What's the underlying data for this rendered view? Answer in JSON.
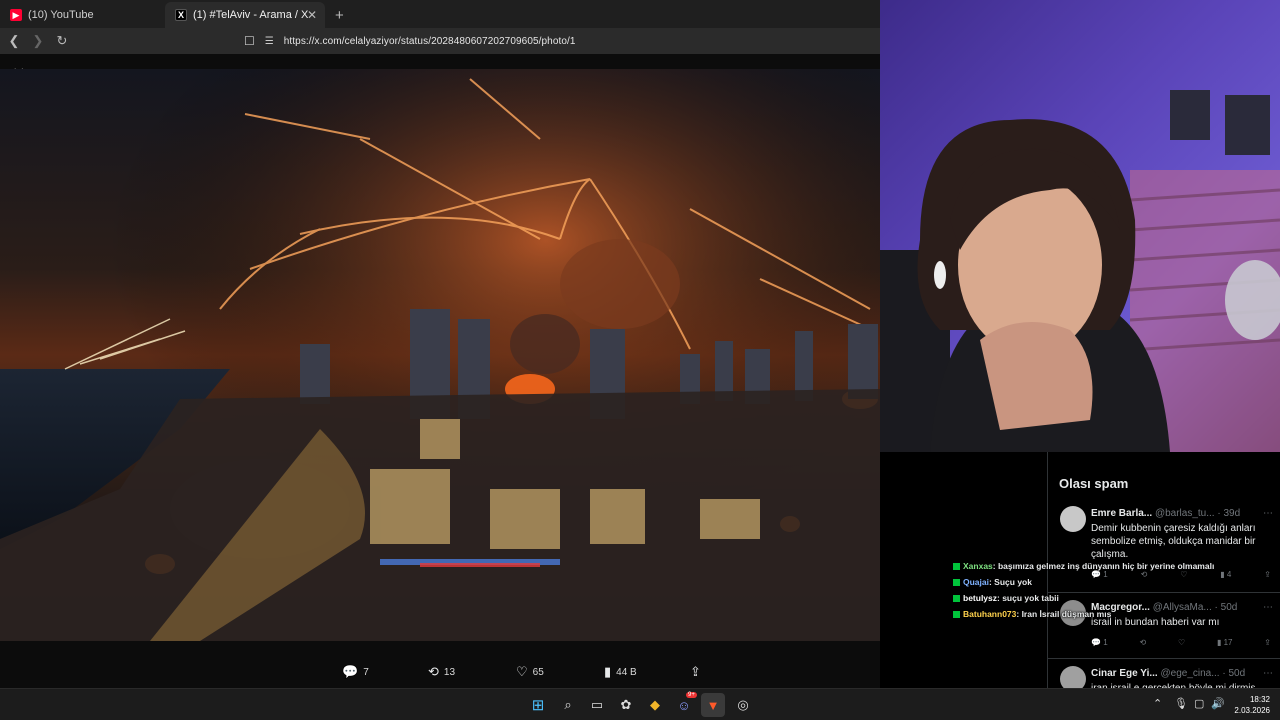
{
  "browser": {
    "tabs": [
      {
        "title": "(10) YouTube",
        "icon": "youtube-icon",
        "active": false
      },
      {
        "title": "(1) #TelAviv - Arama / X",
        "icon": "x-logo-icon",
        "active": true
      }
    ],
    "url": "https://x.com/celalyaziyor/status/2028480607202709605/photo/1"
  },
  "viewer": {
    "actions": {
      "replies": "7",
      "reposts": "13",
      "likes": "65",
      "views": "44 B"
    }
  },
  "sidebar": {
    "title": "Olası spam",
    "tweets": [
      {
        "name": "Emre Barla...",
        "handle": "@barlas_tu...",
        "time": "· 39d",
        "text": "Demir kubbenin çaresiz kaldığı anları sembolize etmiş, oldukça manidar bir çalışma.",
        "replies": "1",
        "reposts": "",
        "likes": "",
        "views": "4"
      },
      {
        "name": "Macgregor...",
        "handle": "@AllysaMa...",
        "time": "· 50d",
        "text": "israil in bundan haberi var mı",
        "replies": "1",
        "reposts": "",
        "likes": "",
        "views": "17"
      },
      {
        "name": "Cinar Ege Yi...",
        "handle": "@ege_cina...",
        "time": "· 50d",
        "text": "iran israil e gerçekten böyle mi dirmiş",
        "replies": "",
        "reposts": "",
        "likes": "",
        "views": ""
      }
    ]
  },
  "chat": [
    {
      "user": "Xanxas",
      "color": "#7ee081",
      "message": ": başımıza gelmez inş dünyanın hiç bir yerine olmamalı"
    },
    {
      "user": "Quajai",
      "color": "#7fb2ff",
      "message": ": Suçu yok"
    },
    {
      "user": "betulysz",
      "color": "#ffffff",
      "message": ": suçu yok tabii"
    },
    {
      "user": "Batuhann073",
      "color": "#ffd24d",
      "message": ": Iran İsrail düşman mıs"
    }
  ],
  "taskbar": {
    "time": "18:32",
    "date": "2.03.2026",
    "discord_badge": "9+"
  }
}
